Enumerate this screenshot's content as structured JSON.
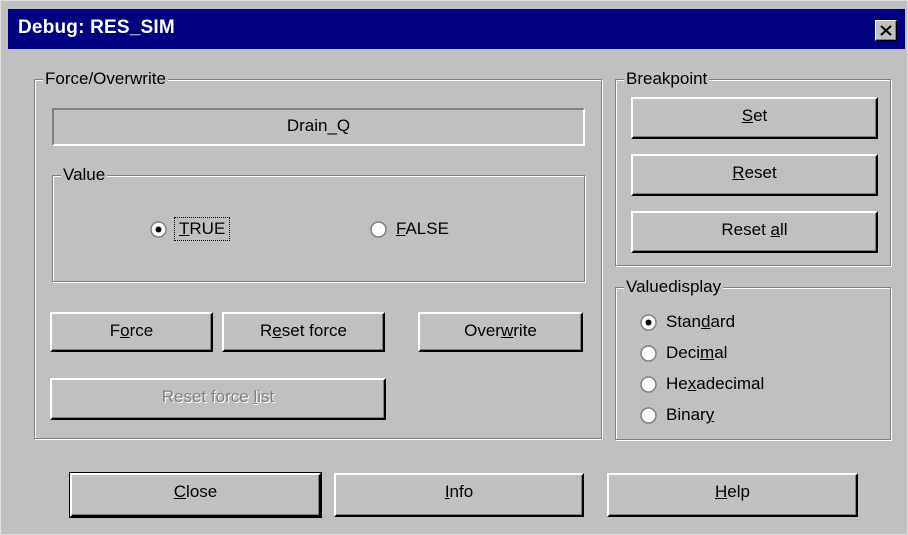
{
  "window": {
    "title": "Debug: RES_SIM"
  },
  "force_group": {
    "legend": "Force/Overwrite",
    "variable_name": "Drain_Q",
    "value_group": {
      "legend": "Value",
      "options": [
        {
          "label": "TRUE",
          "accel": "T",
          "rest": "RUE",
          "selected": true
        },
        {
          "label": "FALSE",
          "accel": "F",
          "rest": "ALSE",
          "selected": false
        }
      ]
    },
    "buttons": {
      "force": {
        "before": "F",
        "accel": "o",
        "after": "rce"
      },
      "reset_force": {
        "before": "R",
        "accel": "e",
        "after": "set force"
      },
      "overwrite": {
        "before": "Over",
        "accel": "w",
        "after": "rite"
      },
      "reset_force_list": {
        "before": "Reset force ",
        "accel": "l",
        "after": "ist",
        "enabled": false
      }
    }
  },
  "breakpoint_group": {
    "legend": "Breakpoint",
    "buttons": {
      "set": {
        "before": "",
        "accel": "S",
        "after": "et"
      },
      "reset": {
        "before": "",
        "accel": "R",
        "after": "eset"
      },
      "reset_all": {
        "before": "Reset ",
        "accel": "a",
        "after": "ll"
      }
    }
  },
  "valuedisplay_group": {
    "legend": "Valuedisplay",
    "options": [
      {
        "before": "Stan",
        "accel": "d",
        "after": "ard",
        "selected": true
      },
      {
        "before": "Deci",
        "accel": "m",
        "after": "al",
        "selected": false
      },
      {
        "before": "He",
        "accel": "x",
        "after": "adecimal",
        "selected": false
      },
      {
        "before": "Binar",
        "accel": "y",
        "after": "",
        "selected": false
      }
    ]
  },
  "footer": {
    "close": {
      "before": "",
      "accel": "C",
      "after": "lose"
    },
    "info": {
      "before": "",
      "accel": "I",
      "after": "nfo"
    },
    "help": {
      "before": "",
      "accel": "H",
      "after": "elp"
    }
  },
  "colors": {
    "titlebar": "#000080",
    "face": "#c0c0c0",
    "disabled_text": "#808080"
  }
}
